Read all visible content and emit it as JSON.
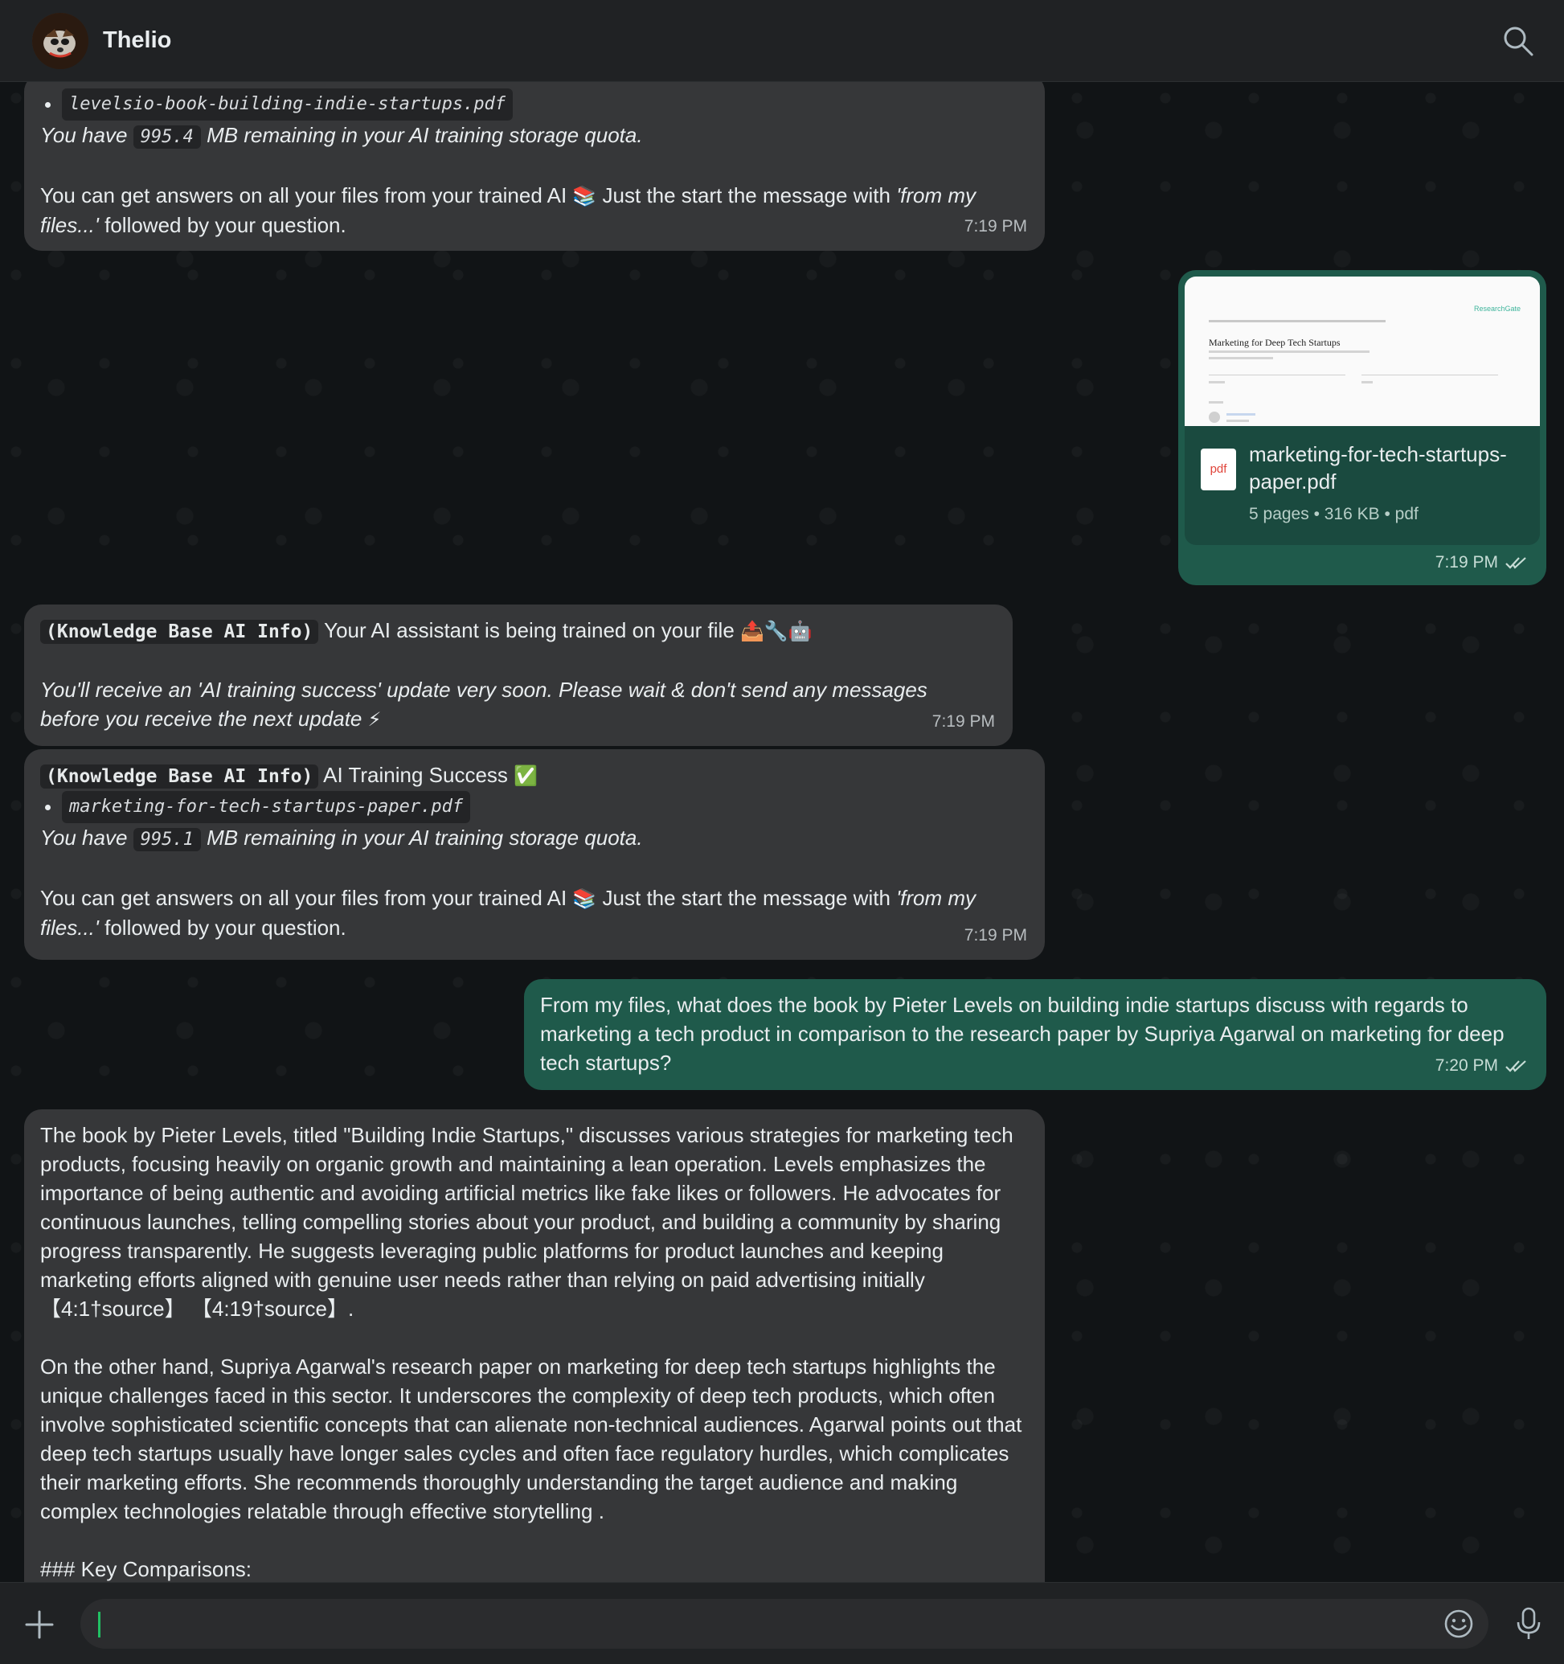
{
  "header": {
    "contact_name": "Thelio",
    "search_icon": "search-icon"
  },
  "messages": {
    "m1": {
      "file_code": "levelsio-book-building-indie-startups.pdf",
      "quota_prefix": "You have",
      "quota_value": "995.4",
      "quota_suffix": "MB remaining in your AI training storage quota.",
      "answers_text": "You can get answers on all your files from your trained AI",
      "answers_emoji": "📚",
      "answers_text2": "Just the start the message with",
      "answers_quote": "'from my files...'",
      "answers_text3": "followed by your question.",
      "time": "7:19 PM"
    },
    "m2": {
      "preview_brand": "ResearchGate",
      "preview_title": "Marketing for Deep Tech Startups",
      "file_name": "marketing-for-tech-startups-paper.pdf",
      "file_icon": "pdf",
      "file_meta": "5 pages • 316 KB • pdf",
      "time": "7:19 PM"
    },
    "m3": {
      "tag": "(Knowledge Base AI Info)",
      "text": "Your AI assistant is being trained on your file",
      "emojis": "📤🔧🤖",
      "notice": "You'll receive an 'AI training success' update very soon. Please wait & don't send any messages before you receive the next update",
      "notice_emoji": "⚡",
      "time": "7:19 PM"
    },
    "m4": {
      "tag": "(Knowledge Base AI Info)",
      "text": "AI Training Success",
      "check_emoji": "✅",
      "file_code": "marketing-for-tech-startups-paper.pdf",
      "quota_prefix": "You have",
      "quota_value": "995.1",
      "quota_suffix": "MB remaining in your AI training storage quota.",
      "answers_text": "You can get answers on all your files from your trained AI",
      "answers_emoji": "📚",
      "answers_text2": "Just the start the message with",
      "answers_quote": "'from my files...'",
      "answers_text3": "followed by your question.",
      "time": "7:19 PM"
    },
    "m5": {
      "text": "From my files, what does the book by Pieter Levels on building indie startups discuss with regards to marketing a tech product in comparison to the research paper by Supriya Agarwal on marketing for deep tech startups?",
      "time": "7:20 PM"
    },
    "m6": {
      "p1": "The book by Pieter Levels, titled \"Building Indie Startups,\" discusses various strategies for marketing tech products, focusing heavily on organic growth and maintaining a lean operation. Levels emphasizes the importance of being authentic and avoiding artificial metrics like fake likes or followers. He advocates for continuous launches, telling compelling stories about your product, and building a community by sharing progress transparently. He suggests leveraging public platforms for product launches and keeping marketing efforts aligned with genuine user needs rather than relying on paid advertising initially 【4:1†source】 【4:19†source】.",
      "p2": "On the other hand, Supriya Agarwal's research paper on marketing for deep tech startups highlights the unique challenges faced in this sector. It underscores the complexity of deep tech products, which often involve sophisticated scientific concepts that can alienate non-technical audiences. Agarwal points out that deep tech startups usually have longer sales cycles and often face regulatory hurdles, which complicates their marketing efforts. She recommends thoroughly understanding the target audience and making complex technologies relatable through effective storytelling .",
      "p3": "### Key Comparisons:"
    }
  },
  "compose": {
    "placeholder": ""
  },
  "colors": {
    "incoming_bubble": "#363739",
    "outgoing_bubble": "#1f5a4b",
    "accent_caret": "#21c063"
  }
}
